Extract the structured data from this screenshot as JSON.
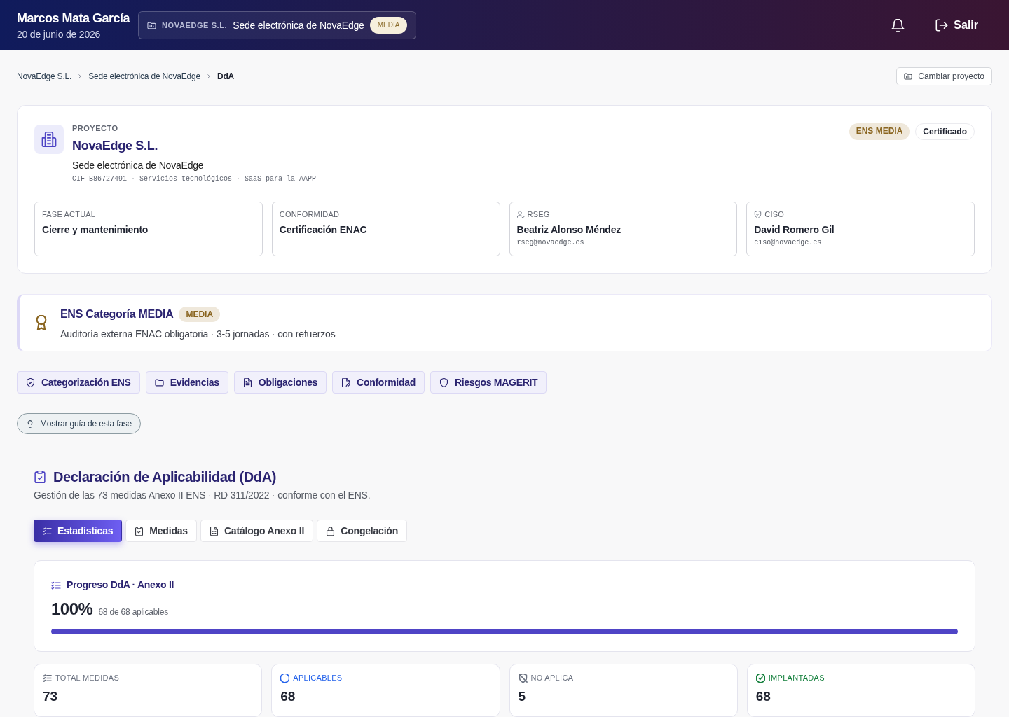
{
  "header": {
    "user_name": "Marcos Mata García",
    "date": "20 de junio de 2026",
    "project_chip": {
      "org": "NOVAEDGE S.L.",
      "name": "Sede electrónica de NovaEdge",
      "badge": "MEDIA"
    },
    "logout": "Salir"
  },
  "breadcrumb": [
    {
      "label": "NovaEdge S.L.",
      "current": false
    },
    {
      "label": "Sede electrónica de NovaEdge",
      "current": false
    },
    {
      "label": "DdA",
      "current": true
    }
  ],
  "change_project_button": "Cambiar proyecto",
  "project": {
    "eyebrow": "PROYECTO",
    "name": "NovaEdge S.L.",
    "subtitle": "Sede electrónica de NovaEdge",
    "meta": "CIF B86727491 · Servicios tecnológicos · SaaS para la AAPP",
    "tags": [
      {
        "label": "ENS MEDIA",
        "kind": "level"
      },
      {
        "label": "Certificado",
        "kind": "status"
      }
    ],
    "info": [
      {
        "label": "FASE ACTUAL",
        "value": "Cierre y mantenimiento",
        "kind": "plain"
      },
      {
        "label": "CONFORMIDAD",
        "value": "Certificación ENAC",
        "kind": "plain"
      },
      {
        "label": "RSEG",
        "value": "Beatriz Alonso Méndez",
        "email": "rseg@novaedge.es",
        "kind": "person"
      },
      {
        "label": "CISO",
        "value": "David Romero Gil",
        "email": "ciso@novaedge.es",
        "kind": "shield"
      }
    ]
  },
  "ens_banner": {
    "title": "ENS Categoría MEDIA",
    "badge": "MEDIA",
    "description": "Auditoría externa ENAC obligatoria · 3-5 jornadas · con refuerzos"
  },
  "modules": [
    {
      "label": "Categorización ENS",
      "kind": "shield-check"
    },
    {
      "label": "Evidencias",
      "kind": "folder"
    },
    {
      "label": "Obligaciones",
      "kind": "document"
    },
    {
      "label": "Conformidad",
      "kind": "edit"
    },
    {
      "label": "Riesgos MAGERIT",
      "kind": "shield-alert"
    }
  ],
  "guide_button": "Mostrar guía de esta fase",
  "section": {
    "title": "Declaración de Aplicabilidad (DdA)",
    "subtitle": "Gestión de las 73 medidas Anexo II ENS · RD 311/2022 · conforme con el ENS.",
    "tabs": [
      {
        "label": "Estadísticas",
        "kind": "list",
        "selected": true
      },
      {
        "label": "Medidas",
        "kind": "clipboard",
        "selected": false
      },
      {
        "label": "Catálogo Anexo II",
        "kind": "sheet",
        "selected": false
      },
      {
        "label": "Congelación",
        "kind": "lock",
        "selected": false
      }
    ],
    "progress": {
      "title": "Progreso DdA · Anexo II",
      "percent": "100%",
      "detail": "68 de 68 aplicables",
      "level": 1
    },
    "stats": [
      {
        "label": "TOTAL MEDIDAS",
        "value": "73",
        "kind": "list",
        "color": "#6b7280"
      },
      {
        "label": "APLICABLES",
        "value": "68",
        "kind": "circle",
        "color": "#2563eb"
      },
      {
        "label": "NO APLICA",
        "value": "5",
        "kind": "slash",
        "color": "#6b7280"
      },
      {
        "label": "IMPLANTADAS",
        "value": "68",
        "kind": "check",
        "color": "#15803d"
      }
    ]
  }
}
